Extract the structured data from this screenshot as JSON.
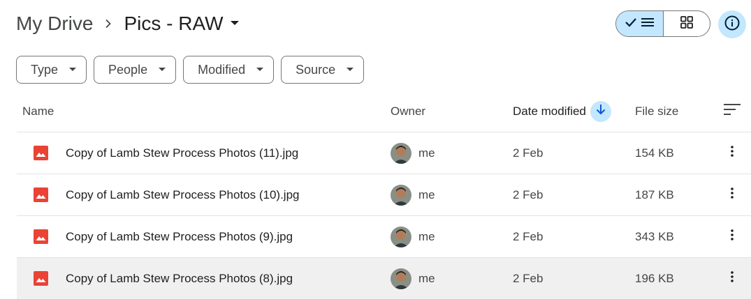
{
  "header": {
    "root_crumb": "My Drive",
    "current_folder": "Pics - RAW"
  },
  "view_toggle": {
    "selected": "list",
    "options": [
      "list",
      "grid"
    ]
  },
  "filters": [
    {
      "label": "Type"
    },
    {
      "label": "People"
    },
    {
      "label": "Modified"
    },
    {
      "label": "Source"
    }
  ],
  "table": {
    "columns": {
      "name": "Name",
      "owner": "Owner",
      "date": "Date modified",
      "size": "File size"
    },
    "sort": {
      "column": "date",
      "direction": "descending"
    },
    "rows": [
      {
        "name": "Copy of Lamb Stew Process Photos (11).jpg",
        "owner": "me",
        "date": "2 Feb",
        "size": "154 KB"
      },
      {
        "name": "Copy of Lamb Stew Process Photos (10).jpg",
        "owner": "me",
        "date": "2 Feb",
        "size": "187 KB"
      },
      {
        "name": "Copy of Lamb Stew Process Photos (9).jpg",
        "owner": "me",
        "date": "2 Feb",
        "size": "343 KB"
      },
      {
        "name": "Copy of Lamb Stew Process Photos (8).jpg",
        "owner": "me",
        "date": "2 Feb",
        "size": "196 KB"
      }
    ]
  },
  "colors": {
    "accent": "#c2e7ff",
    "image_icon": "#ea4335",
    "text": "#1f1f1f",
    "muted": "#444746",
    "divider": "#e1e3e1",
    "hover_row": "#f0f0f0"
  },
  "icons": {
    "breadcrumb_separator": "chevron-right-icon",
    "folder_menu": "caret-down-icon",
    "list_view": "list-icon",
    "grid_view": "grid-icon",
    "info": "info-icon",
    "sort": "arrow-down-icon",
    "sort_options": "sort-lines-icon",
    "file": "image-file-icon",
    "row_menu": "more-vert-icon"
  }
}
